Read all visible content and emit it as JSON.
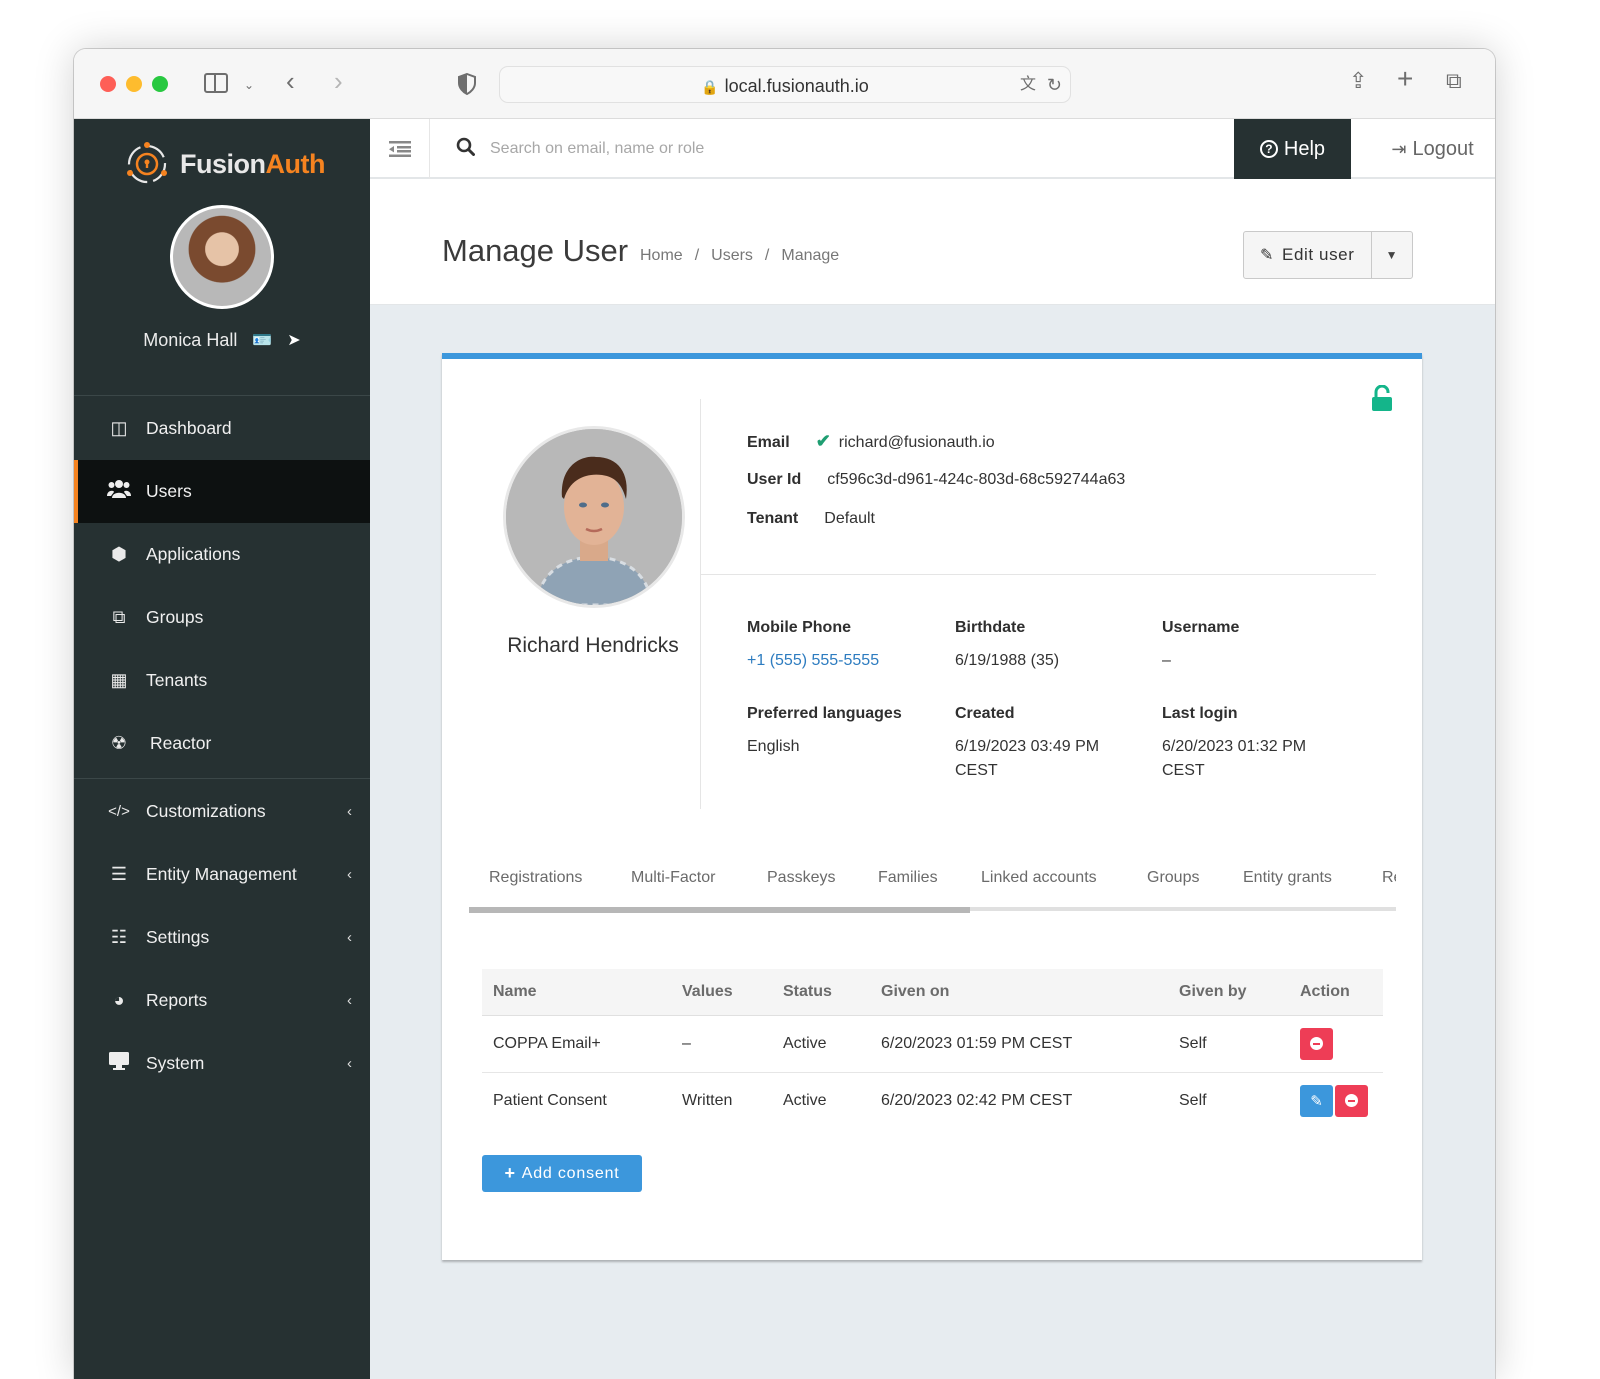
{
  "browser": {
    "url": "local.fusionauth.io"
  },
  "brand": {
    "name_part1": "Fusion",
    "name_part2": "Auth",
    "accent": "#f58320"
  },
  "admin": {
    "name": "Monica Hall"
  },
  "sidebar": {
    "items": [
      {
        "label": "Dashboard",
        "icon": "dashboard-icon",
        "glyph": "◫",
        "active": false
      },
      {
        "label": "Users",
        "icon": "users-icon",
        "glyph": "👥",
        "active": true
      },
      {
        "label": "Applications",
        "icon": "cube-icon",
        "glyph": "⬢",
        "active": false
      },
      {
        "label": "Groups",
        "icon": "groups-icon",
        "glyph": "⧉",
        "active": false
      },
      {
        "label": "Tenants",
        "icon": "building-icon",
        "glyph": "▦",
        "active": false
      },
      {
        "label": "Reactor",
        "icon": "reactor-icon",
        "glyph": "☢",
        "active": false
      }
    ],
    "sections": [
      {
        "label": "Customizations",
        "icon": "code-icon",
        "glyph": "</>"
      },
      {
        "label": "Entity Management",
        "icon": "server-icon",
        "glyph": "☰"
      },
      {
        "label": "Settings",
        "icon": "sliders-icon",
        "glyph": "☷"
      },
      {
        "label": "Reports",
        "icon": "pie-chart-icon",
        "glyph": "◕"
      },
      {
        "label": "System",
        "icon": "desktop-icon",
        "glyph": "🖵"
      }
    ]
  },
  "topbar": {
    "search_placeholder": "Search on email, name or role",
    "help_label": "Help",
    "logout_label": "Logout"
  },
  "header": {
    "title": "Manage User",
    "breadcrumb": [
      "Home",
      "Users",
      "Manage"
    ],
    "edit_label": "Edit user"
  },
  "user": {
    "full_name": "Richard Hendricks",
    "email_label": "Email",
    "email": "richard@fusionauth.io",
    "email_verified": true,
    "user_id_label": "User Id",
    "user_id": "cf596c3d-d961-424c-803d-68c592744a63",
    "tenant_label": "Tenant",
    "tenant": "Default",
    "fields": [
      {
        "label": "Mobile Phone",
        "value": "+1 (555) 555-5555",
        "link": true
      },
      {
        "label": "Birthdate",
        "value": "6/19/1988 (35)"
      },
      {
        "label": "Username",
        "value": "–"
      },
      {
        "label": "Preferred languages",
        "value": "English"
      },
      {
        "label": "Created",
        "value": "6/19/2023 03:49 PM CEST"
      },
      {
        "label": "Last login",
        "value": "6/20/2023 01:32 PM CEST"
      }
    ],
    "locked": false
  },
  "tabs": [
    "Registrations",
    "Multi-Factor",
    "Passkeys",
    "Families",
    "Linked accounts",
    "Groups",
    "Entity grants",
    "Re"
  ],
  "tab_scroll_fraction": 0.54,
  "consents": {
    "columns": [
      "Name",
      "Values",
      "Status",
      "Given on",
      "Given by",
      "Action"
    ],
    "rows": [
      {
        "name": "COPPA Email+",
        "values": "–",
        "status": "Active",
        "given_on": "6/20/2023 01:59 PM CEST",
        "given_by": "Self",
        "actions": [
          "revoke"
        ]
      },
      {
        "name": "Patient Consent",
        "values": "Written",
        "status": "Active",
        "given_on": "6/20/2023 02:42 PM CEST",
        "given_by": "Self",
        "actions": [
          "edit",
          "revoke"
        ]
      }
    ],
    "add_label": "Add consent"
  }
}
